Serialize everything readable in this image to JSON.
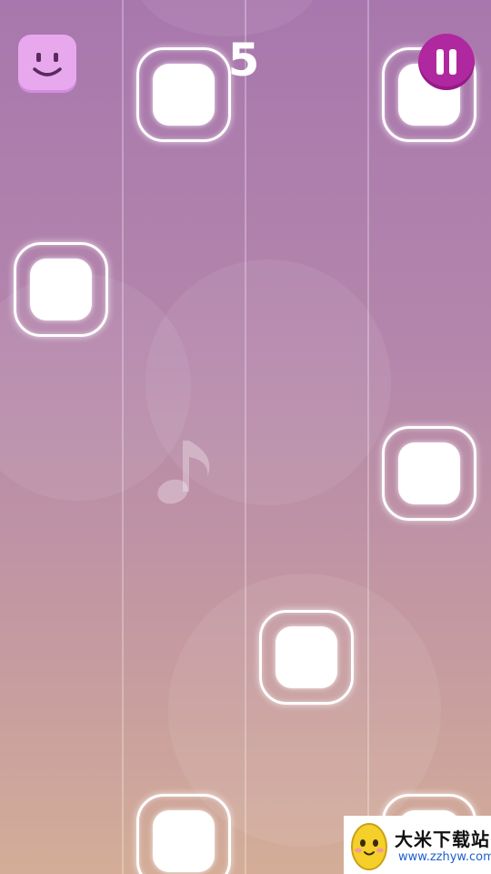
{
  "hud": {
    "score": "5"
  },
  "colors": {
    "tile": "#ffffff",
    "pause_button": "#b0289f",
    "smiley_button": "#e7a8ee",
    "lane_line": "rgba(255,255,255,0.28)"
  },
  "icons": [
    "smiley-face-icon",
    "pause-icon",
    "music-note-icon"
  ],
  "watermark": {
    "title": "大米下载站",
    "url": "www.zzhyw.com"
  }
}
